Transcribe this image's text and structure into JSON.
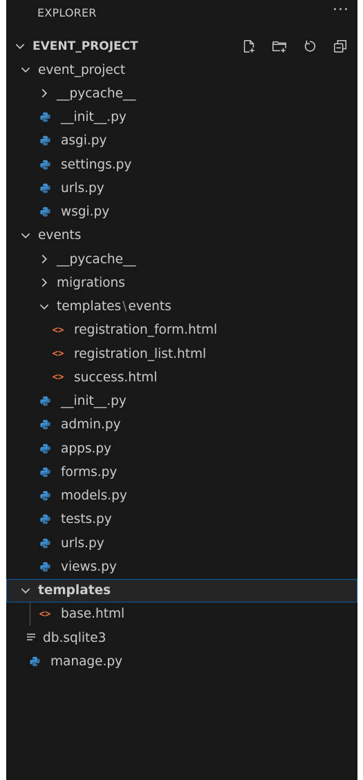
{
  "explorer": {
    "title": "EXPLORER",
    "more_label": "···",
    "root": {
      "label": "EVENT_PROJECT",
      "actions": [
        "new-file-icon",
        "new-folder-icon",
        "refresh-icon",
        "collapse-all-icon"
      ]
    },
    "items": [
      {
        "label": "event_project",
        "type": "folder-open"
      },
      {
        "label": "__pycache__",
        "type": "folder-closed"
      },
      {
        "label": "__init__.py",
        "type": "python"
      },
      {
        "label": "asgi.py",
        "type": "python"
      },
      {
        "label": "settings.py",
        "type": "python"
      },
      {
        "label": "urls.py",
        "type": "python"
      },
      {
        "label": "wsgi.py",
        "type": "python"
      },
      {
        "label": "events",
        "type": "folder-open"
      },
      {
        "label": "__pycache__",
        "type": "folder-closed"
      },
      {
        "label": "migrations",
        "type": "folder-closed"
      },
      {
        "label": "templates",
        "sep": "\\",
        "label2": "events",
        "type": "folder-open"
      },
      {
        "label": "registration_form.html",
        "type": "html"
      },
      {
        "label": "registration_list.html",
        "type": "html"
      },
      {
        "label": "success.html",
        "type": "html"
      },
      {
        "label": "__init__.py",
        "type": "python"
      },
      {
        "label": "admin.py",
        "type": "python"
      },
      {
        "label": "apps.py",
        "type": "python"
      },
      {
        "label": "forms.py",
        "type": "python"
      },
      {
        "label": "models.py",
        "type": "python"
      },
      {
        "label": "tests.py",
        "type": "python"
      },
      {
        "label": "urls.py",
        "type": "python"
      },
      {
        "label": "views.py",
        "type": "python"
      },
      {
        "label": "templates",
        "type": "folder-open",
        "selected": true
      },
      {
        "label": "base.html",
        "type": "html"
      },
      {
        "label": "db.sqlite3",
        "type": "database"
      },
      {
        "label": "manage.py",
        "type": "python"
      }
    ],
    "colors": {
      "background": "#181818",
      "text": "#cccccc",
      "python_icon": "#3d8fd1",
      "html_icon": "#e8713a",
      "selection_border": "#0b5cad"
    }
  }
}
